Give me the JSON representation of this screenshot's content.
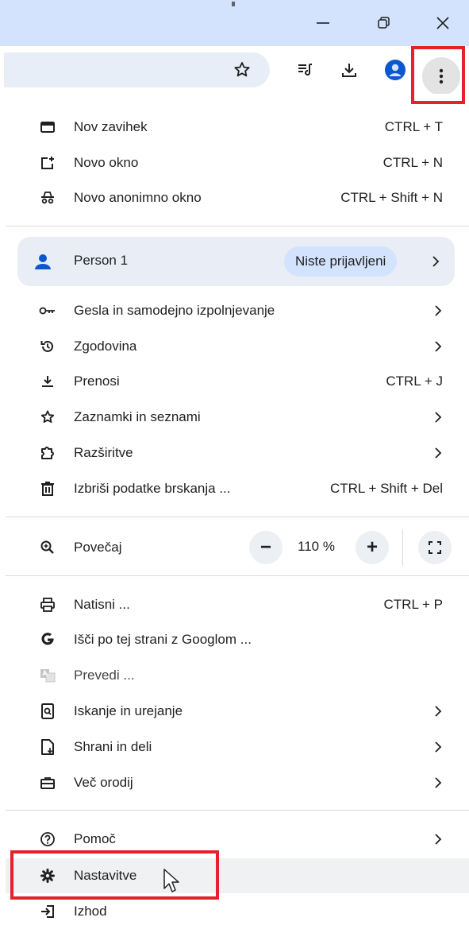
{
  "window": {
    "minimize_icon": "minimize-icon",
    "restore_icon": "restore-icon",
    "close_icon": "close-icon"
  },
  "toolbar": {
    "icons": [
      "star-icon",
      "reading-list-icon",
      "download-icon",
      "profile-icon",
      "more-vertical-icon"
    ]
  },
  "menu": {
    "new_tab": {
      "label": "Nov zavihek",
      "shortcut": "CTRL + T"
    },
    "new_window": {
      "label": "Novo okno",
      "shortcut": "CTRL + N"
    },
    "incognito": {
      "label": "Novo anonimno okno",
      "shortcut": "CTRL + Shift + N"
    },
    "profile": {
      "name": "Person 1",
      "status": "Niste prijavljeni"
    },
    "passwords": {
      "label": "Gesla in samodejno izpolnjevanje"
    },
    "history": {
      "label": "Zgodovina"
    },
    "downloads": {
      "label": "Prenosi",
      "shortcut": "CTRL + J"
    },
    "bookmarks": {
      "label": "Zaznamki in seznami"
    },
    "extensions": {
      "label": "Razširitve"
    },
    "clear_data": {
      "label": "Izbriši podatke brskanja ...",
      "shortcut": "CTRL + Shift + Del"
    },
    "zoom": {
      "label": "Povečaj",
      "value": "110 %",
      "minus": "−",
      "plus": "+"
    },
    "print": {
      "label": "Natisni ...",
      "shortcut": "CTRL + P"
    },
    "search_google": {
      "label": "Išči po tej strani z Googlom ..."
    },
    "translate": {
      "label": "Prevedi ..."
    },
    "find_edit": {
      "label": "Iskanje in urejanje"
    },
    "save_share": {
      "label": "Shrani in deli"
    },
    "more_tools": {
      "label": "Več orodij"
    },
    "help": {
      "label": "Pomoč"
    },
    "settings": {
      "label": "Nastavitve"
    },
    "exit": {
      "label": "Izhod"
    }
  },
  "colors": {
    "accent": "#0b57d0",
    "highlight_box": "#e3222b",
    "titlebar": "#d3e3fd",
    "pill": "#d3e3fd"
  }
}
